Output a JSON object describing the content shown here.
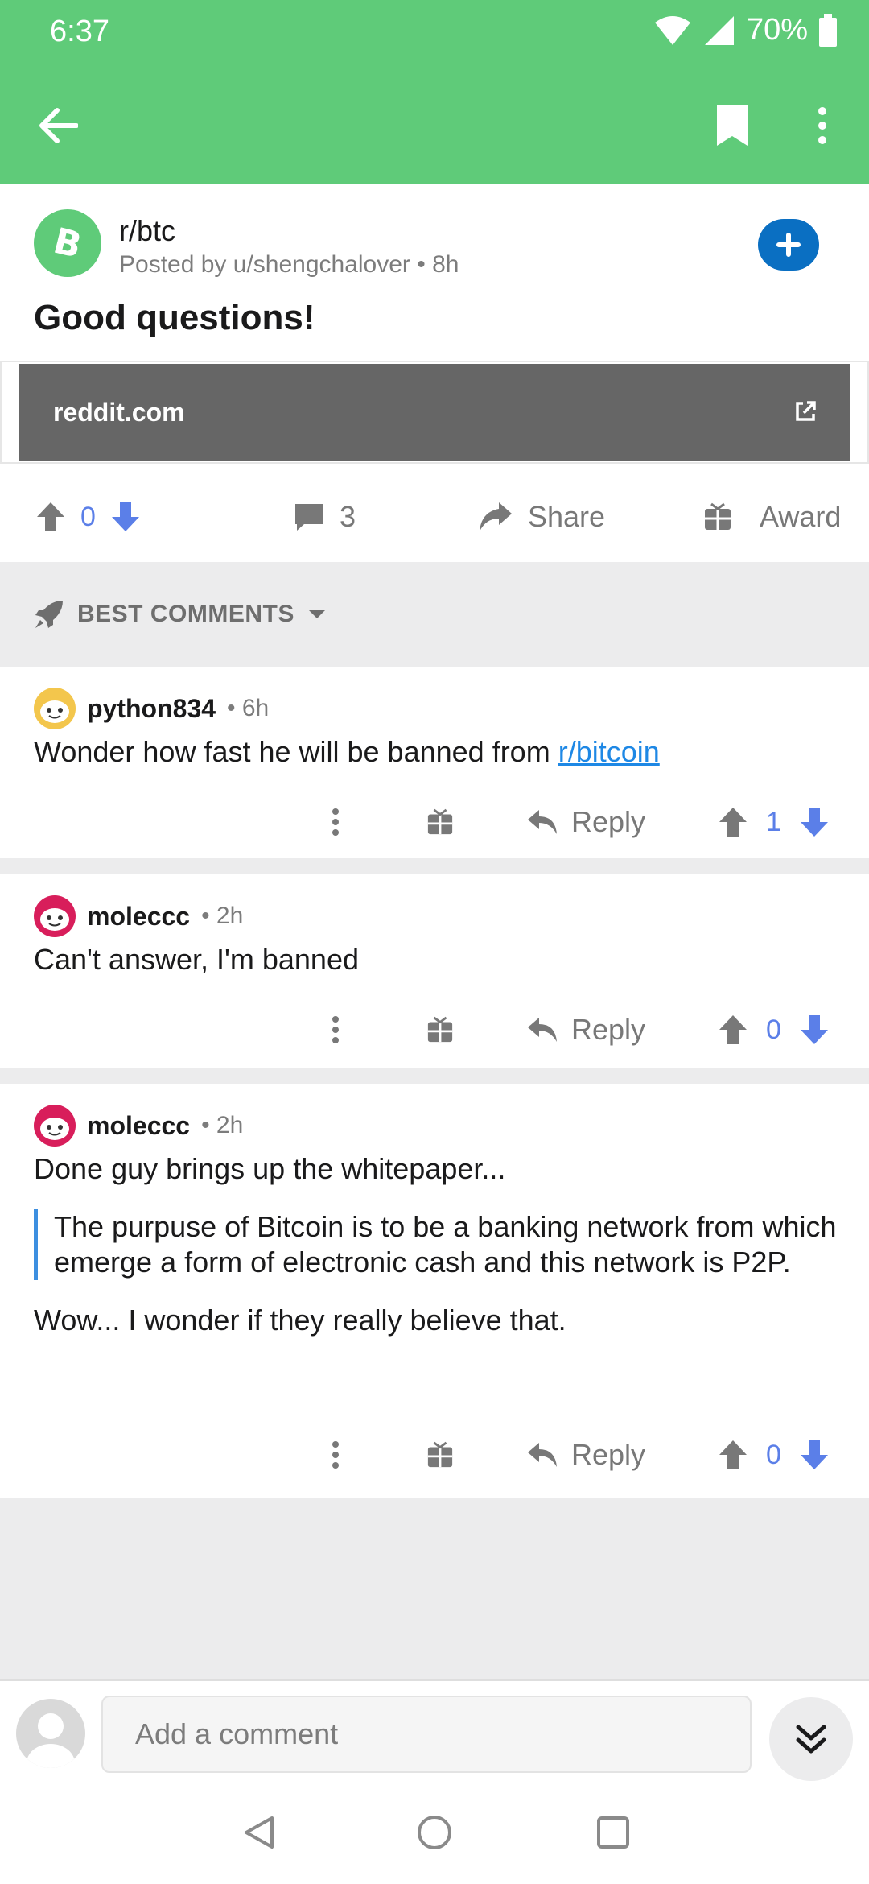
{
  "status_bar": {
    "time": "6:37",
    "battery": "70%"
  },
  "app_bar": {
    "back_icon": "arrow-left-icon",
    "bookmark_icon": "bookmark-icon",
    "menu_icon": "more-vert-icon"
  },
  "post": {
    "subreddit": "r/btc",
    "posted_by": "Posted by u/shengchalover • 8h",
    "title": "Good questions!",
    "link_domain": "reddit.com",
    "votes": "0",
    "comments": "3",
    "share_label": "Share",
    "award_label": "Award"
  },
  "sort": {
    "label": "BEST COMMENTS"
  },
  "comments": [
    {
      "user": "python834",
      "age": "• 6h",
      "text_before": "Wonder how fast he will be banned from ",
      "link": "r/bitcoin",
      "reply_label": "Reply",
      "votes": "1"
    },
    {
      "user": "moleccc",
      "age": "• 2h",
      "text": "Can't answer, I'm banned",
      "reply_label": "Reply",
      "votes": "0"
    },
    {
      "user": "moleccc",
      "age": "• 2h",
      "text_intro": "Done guy brings up the whitepaper...",
      "quote": "The purpuse of Bitcoin is to be a banking network from which emerge a form of electronic cash and this network is P2P.",
      "text_outro": "Wow... I wonder if they really believe that.",
      "reply_label": "Reply",
      "votes": "0"
    }
  ],
  "comment_bar": {
    "placeholder": "Add a comment"
  },
  "colors": {
    "accent_green": "#5fcb79",
    "vote_blue": "#5b7fe8",
    "join_blue": "#0a6fc2"
  }
}
